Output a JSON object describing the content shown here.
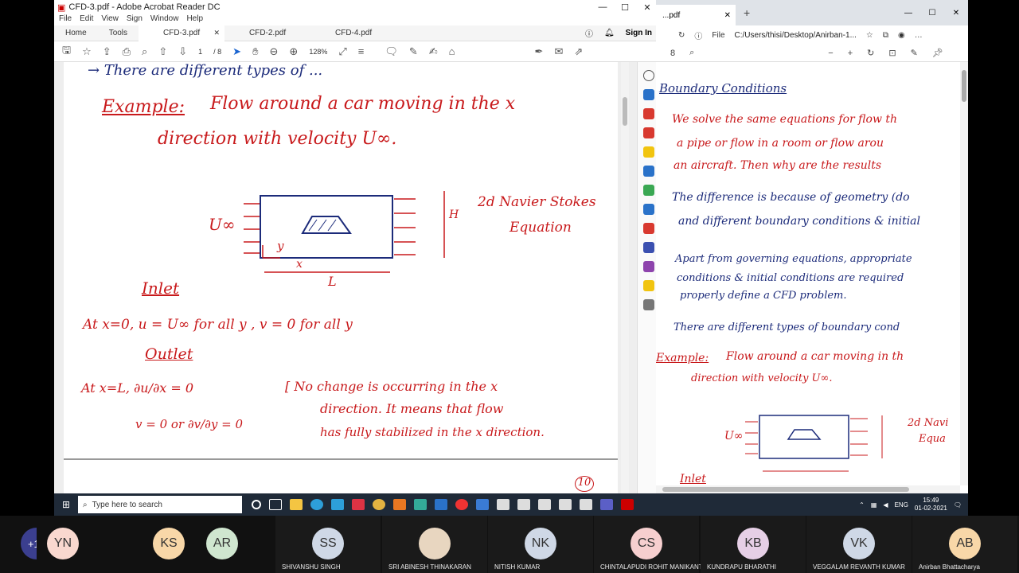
{
  "acrobat": {
    "title": "CFD-3.pdf - Adobe Acrobat Reader DC",
    "menu": [
      "File",
      "Edit",
      "View",
      "Sign",
      "Window",
      "Help"
    ],
    "nav": [
      "Home",
      "Tools"
    ],
    "tabs": [
      "CFD-3.pdf",
      "CFD-2.pdf",
      "CFD-4.pdf"
    ],
    "sign_in": "Sign In",
    "page_current": "1",
    "page_total": "/ 8",
    "zoom": "128%"
  },
  "notes_left": {
    "line0": "→  There are different types of ...",
    "example": "Example:",
    "example_text1": "Flow around a car moving in the x",
    "example_text2": "direction with velocity U∞.",
    "u_label": "U∞",
    "navier1": "2d Navier Stokes",
    "navier2": "Equation",
    "h_label": "H",
    "l_label": "L",
    "x_label": "x",
    "y_label": "y",
    "inlet": "Inlet",
    "inlet_eq": "At x=0,   u = U∞  for all y   ,   v = 0   for all y",
    "outlet": "Outlet",
    "outlet_eq1": "At x=L,  ∂u/∂x = 0",
    "outlet_eq2": "v = 0   or  ∂v/∂y = 0",
    "outlet_note1": "[ No change is occurring in the x",
    "outlet_note2": "direction. It means that flow",
    "outlet_note3": "has fully stabilized in the x direction.",
    "page_num": "10"
  },
  "edge": {
    "tab_title": "...pdf",
    "address_label": "File",
    "address": "C:/Users/thisi/Desktop/Anirban-1...",
    "page_indicator": "8"
  },
  "notes_right": {
    "heading": "Boundary Conditions",
    "p1a": "We solve the same equations for flow th",
    "p1b": "a pipe or flow in a room or flow arou",
    "p1c": "an aircraft. Then why are the results",
    "p2a": "The difference is because of geometry (do",
    "p2b": "and different boundary conditions & initial",
    "p3a": "Apart from governing equations, appropriate",
    "p3b": "conditions & initial conditions are required",
    "p3c": "properly define a CFD problem.",
    "p4": "There are different types of boundary cond",
    "example": "Example:",
    "ex1": "Flow around a car moving in th",
    "ex2": "direction with velocity U∞.",
    "navier1": "2d Navi",
    "navier2": "Equa",
    "u_label": "U∞",
    "inlet": "Inlet"
  },
  "taskbar": {
    "search_placeholder": "Type here to search",
    "lang": "ENG",
    "time": "15:49",
    "date": "01-02-2021"
  },
  "participants": {
    "more": "+16",
    "tiles": [
      {
        "initials": "YN",
        "name": "",
        "color": "#f9d8cf"
      },
      {
        "initials": "KS",
        "name": "",
        "color": "#f8d7a8"
      },
      {
        "initials": "AR",
        "name": "",
        "color": "#cfe6cf"
      },
      {
        "initials": "SS",
        "name": "SHIVANSHU SINGH",
        "color": "#cfd8e6"
      },
      {
        "initials": "",
        "name": "SRI ABINESH THINAKARAN",
        "color": "#e8d6c0"
      },
      {
        "initials": "NK",
        "name": "NITISH KUMAR",
        "color": "#cfd8e6"
      },
      {
        "initials": "CS",
        "name": "CHINTALAPUDI ROHIT MANIKANT...",
        "color": "#f6cfcf"
      },
      {
        "initials": "KB",
        "name": "KUNDRAPU BHARATHI",
        "color": "#e6cfe6"
      },
      {
        "initials": "VK",
        "name": "VEGGALAM REVANTH KUMAR",
        "color": "#cfd8e6"
      },
      {
        "initials": "AB",
        "name": "Anirban Bhattacharya",
        "color": "#f8d7a8"
      }
    ]
  }
}
